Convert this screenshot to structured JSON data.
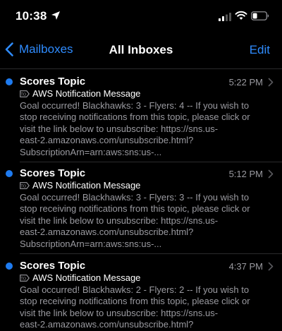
{
  "status": {
    "time": "10:38"
  },
  "nav": {
    "back_label": "Mailboxes",
    "title": "All Inboxes",
    "edit_label": "Edit"
  },
  "messages": [
    {
      "sender": "Scores Topic",
      "time": "5:22 PM",
      "subject": "AWS Notification Message",
      "preview": [
        "Goal occurred! Blackhawks: 3 - Flyers: 4 -- If you wish to",
        "stop receiving notifications from this topic, please click or",
        "visit the link below to unsubscribe: https://sns.us-",
        "east-2.amazonaws.com/unsubscribe.html?",
        "SubscriptionArn=arn:aws:sns:us-..."
      ],
      "unread": true
    },
    {
      "sender": "Scores Topic",
      "time": "5:12 PM",
      "subject": "AWS Notification Message",
      "preview": [
        "Goal occurred! Blackhawks: 3 - Flyers: 3 -- If you wish to",
        "stop receiving notifications from this topic, please click or",
        "visit the link below to unsubscribe: https://sns.us-",
        "east-2.amazonaws.com/unsubscribe.html?",
        "SubscriptionArn=arn:aws:sns:us-..."
      ],
      "unread": true
    },
    {
      "sender": "Scores Topic",
      "time": "4:37 PM",
      "subject": "AWS Notification Message",
      "preview": [
        "Goal occurred! Blackhawks: 2 - Flyers: 2 -- If you wish to",
        "stop receiving notifications from this topic, please click or",
        "visit the link below to unsubscribe: https://sns.us-",
        "east-2.amazonaws.com/unsubscribe.html?"
      ],
      "unread": true
    }
  ],
  "icons": {
    "location": "location-arrow-icon",
    "signal": "cellular-signal-icon",
    "wifi": "wifi-icon",
    "battery": "battery-icon",
    "back": "chevron-left-icon",
    "row": "chevron-right-icon",
    "tag": "tag-icon"
  },
  "colors": {
    "accent": "#2f8cff",
    "unread_dot": "#1e7bf0",
    "secondary_text": "#9a9aa0",
    "background": "#000000"
  }
}
